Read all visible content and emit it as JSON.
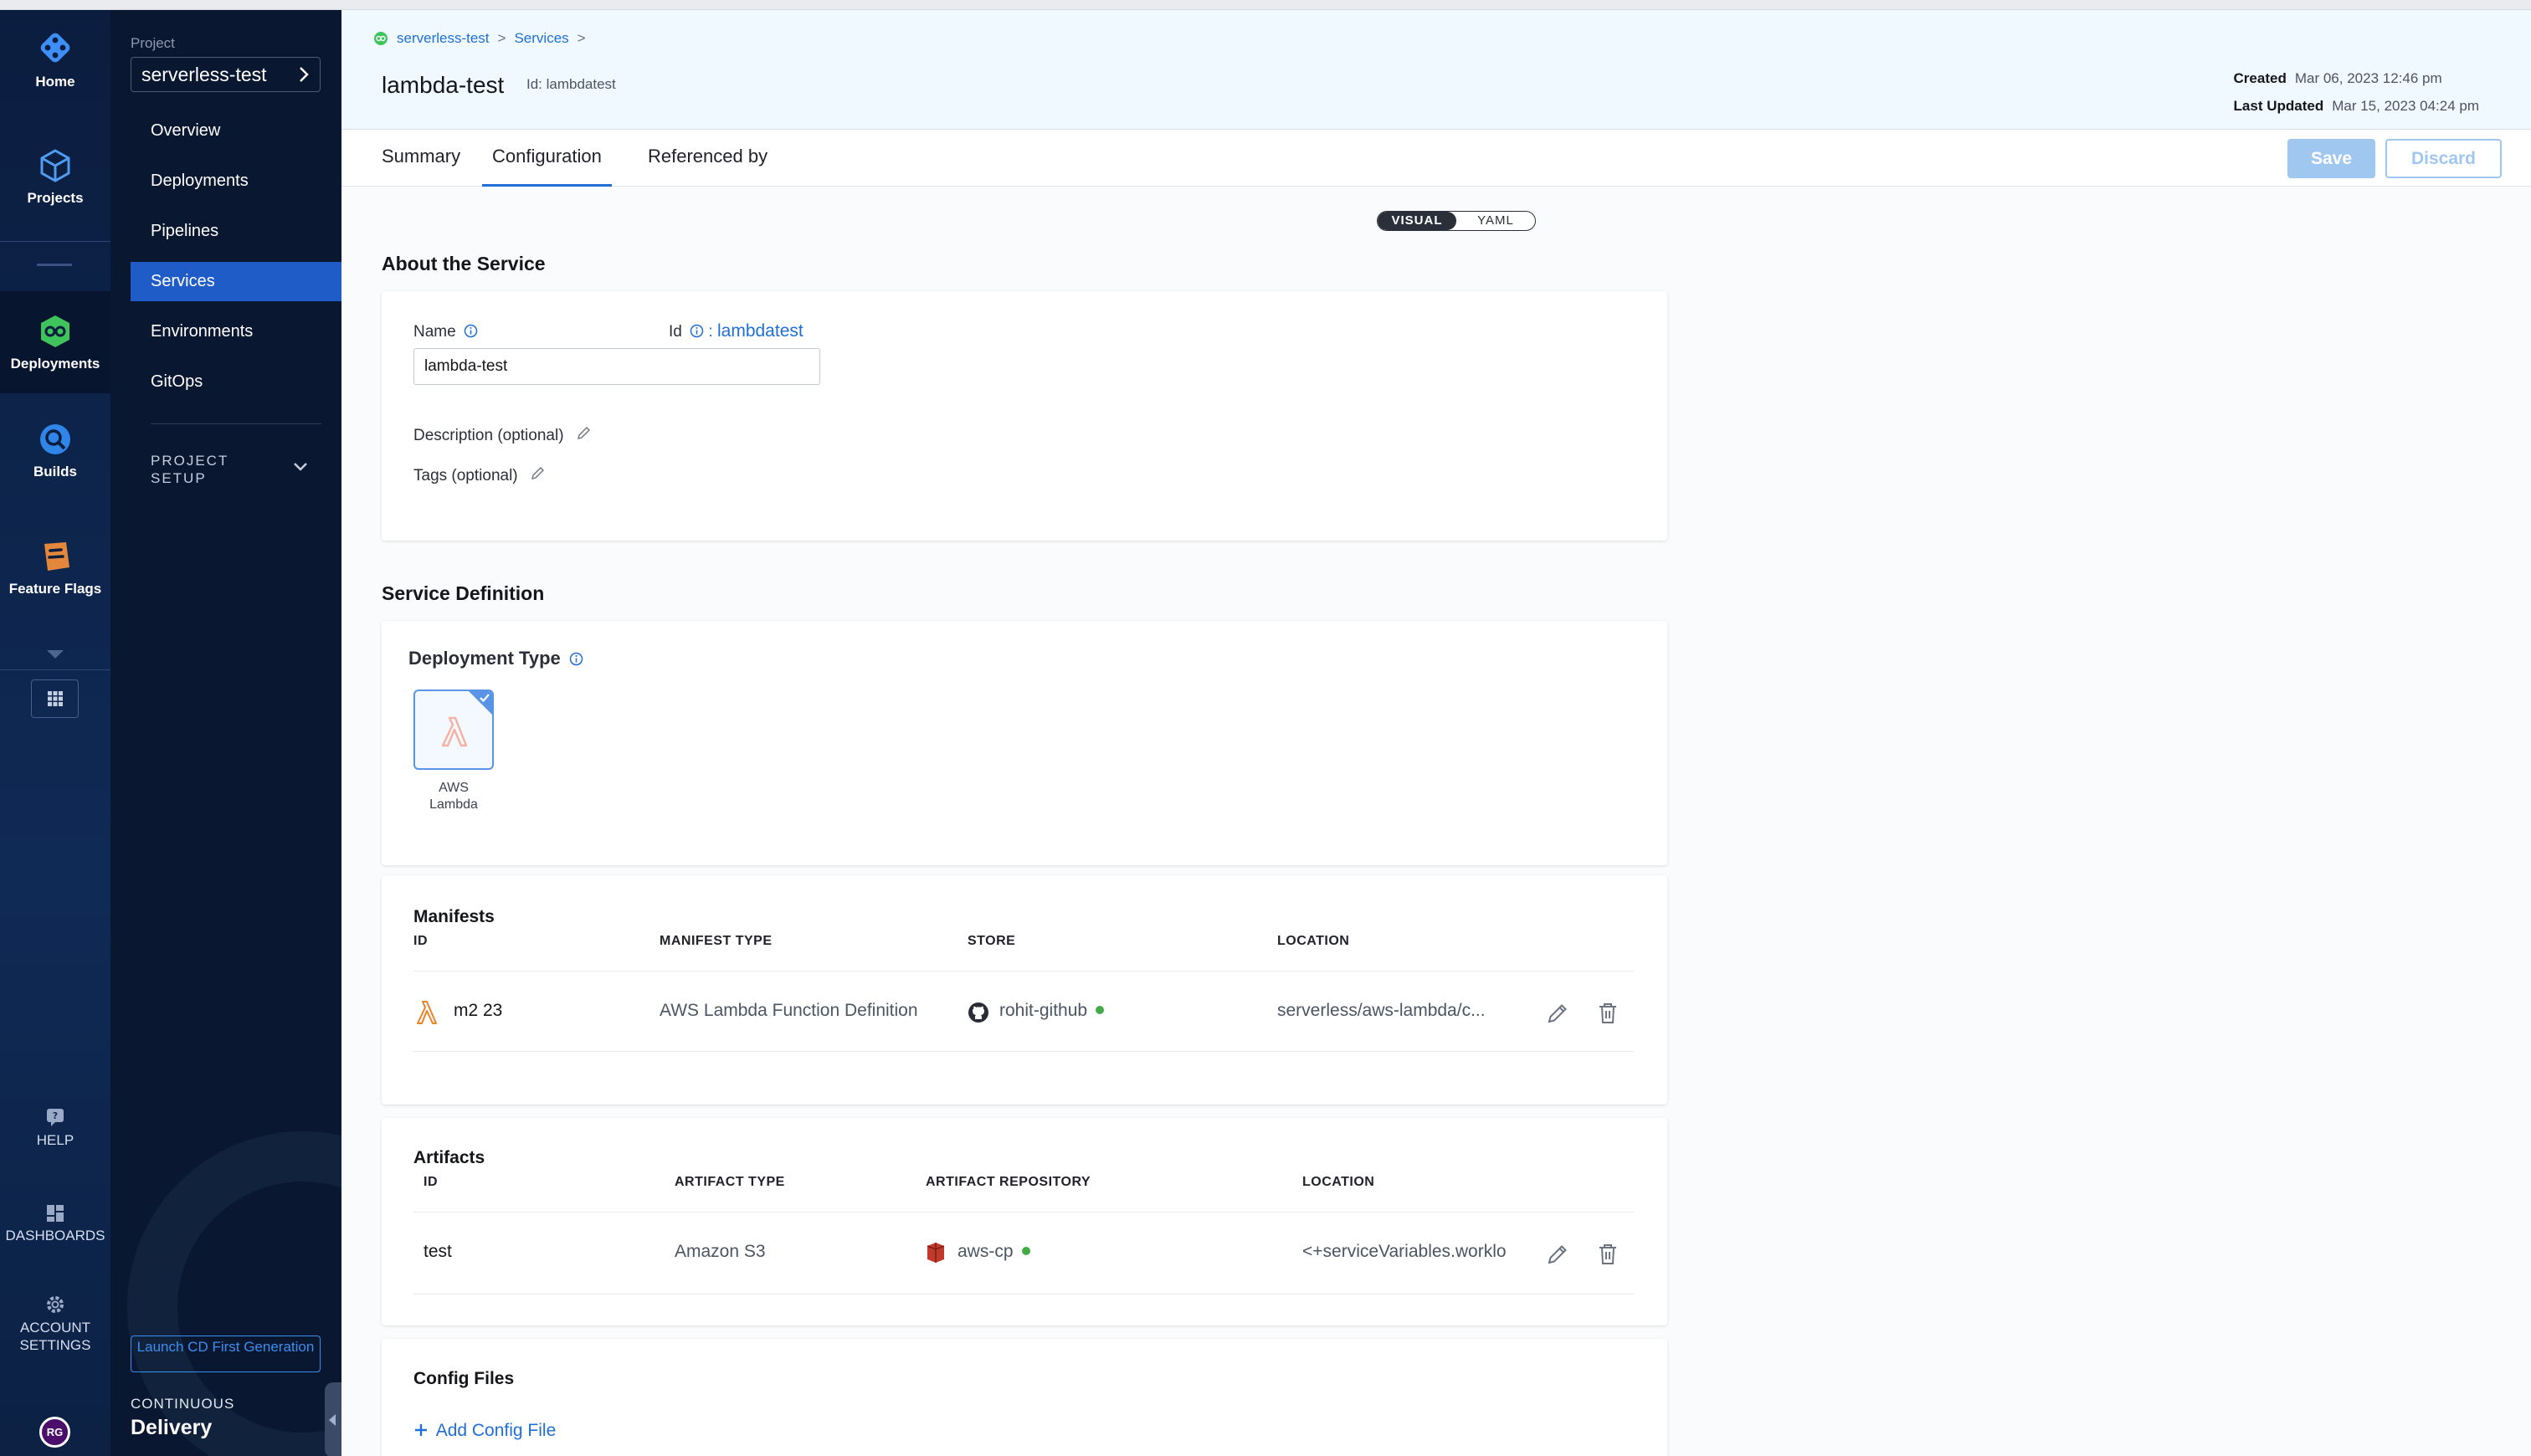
{
  "nav": {
    "home": "Home",
    "projects": "Projects",
    "deployments": "Deployments",
    "builds": "Builds",
    "feature_flags": "Feature Flags",
    "help": "HELP",
    "dashboards": "DASHBOARDS",
    "account_settings_1": "ACCOUNT",
    "account_settings_2": "SETTINGS",
    "avatar": "RG"
  },
  "panel": {
    "project_label": "Project",
    "project_name": "serverless-test",
    "items": [
      {
        "label": "Overview"
      },
      {
        "label": "Deployments"
      },
      {
        "label": "Pipelines"
      },
      {
        "label": "Services"
      },
      {
        "label": "Environments"
      },
      {
        "label": "GitOps"
      }
    ],
    "setup_1": "PROJECT",
    "setup_2": "SETUP",
    "launch_btn": "Launch CD First Generation",
    "module_small": "CONTINUOUS",
    "module_big": "Delivery"
  },
  "header": {
    "breadcrumb_project": "serverless-test",
    "breadcrumb_services": "Services",
    "title": "lambda-test",
    "id_label": "Id: lambdatest",
    "created_label": "Created",
    "created_value": "Mar 06, 2023 12:46 pm",
    "updated_label": "Last Updated",
    "updated_value": "Mar 15, 2023 04:24 pm"
  },
  "tabs": {
    "summary": "Summary",
    "configuration": "Configuration",
    "referenced_by": "Referenced by",
    "save": "Save",
    "discard": "Discard"
  },
  "toggle": {
    "visual": "VISUAL",
    "yaml": "YAML"
  },
  "about": {
    "heading": "About the Service",
    "name_label": "Name",
    "id_label": "Id",
    "id_value": "lambdatest",
    "name_value": "lambda-test",
    "description": "Description (optional)",
    "tags": "Tags (optional)"
  },
  "definition": {
    "heading": "Service Definition",
    "deployment_type_label": "Deployment Type",
    "tile_line1": "AWS",
    "tile_line2": "Lambda"
  },
  "manifests": {
    "heading": "Manifests",
    "columns": [
      "ID",
      "MANIFEST TYPE",
      "STORE",
      "LOCATION"
    ],
    "rows": [
      {
        "id": "m2 23",
        "type": "AWS Lambda Function Definition",
        "store": "rohit-github",
        "location": "serverless/aws-lambda/c..."
      }
    ]
  },
  "artifacts": {
    "heading": "Artifacts",
    "columns": [
      "ID",
      "ARTIFACT TYPE",
      "ARTIFACT REPOSITORY",
      "LOCATION"
    ],
    "rows": [
      {
        "id": "test",
        "type": "Amazon S3",
        "repo": "aws-cp",
        "location": "<+serviceVariables.worklo"
      }
    ]
  },
  "config_files": {
    "heading": "Config Files",
    "add_label": "Add Config File"
  }
}
